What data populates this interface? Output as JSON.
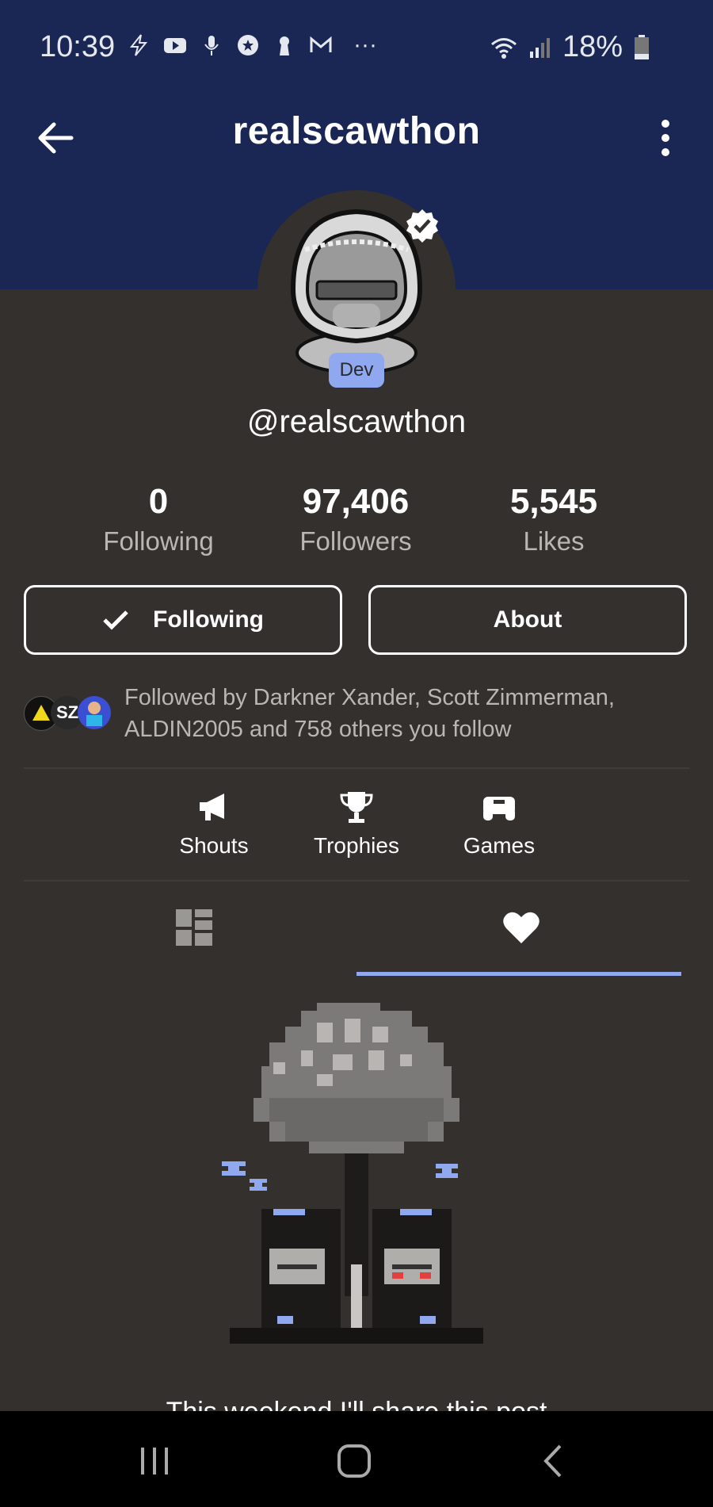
{
  "status_bar": {
    "time": "10:39",
    "battery": "18%",
    "overflow": "···"
  },
  "header": {
    "title": "realscawthon",
    "accent_color": "#1a2654"
  },
  "profile": {
    "handle": "@realscawthon",
    "badge": "Dev",
    "verified": true
  },
  "stats": [
    {
      "value": "0",
      "label": "Following"
    },
    {
      "value": "97,406",
      "label": "Followers"
    },
    {
      "value": "5,545",
      "label": "Likes"
    }
  ],
  "actions": {
    "following_label": "Following",
    "about_label": "About"
  },
  "followed_by": {
    "text": "Followed by Darkner Xander, Scott Zimmerman, ALDIN2005 and 758 others you follow",
    "mini_label": "SZ"
  },
  "quick_links": [
    {
      "label": "Shouts",
      "icon": "megaphone-icon"
    },
    {
      "label": "Trophies",
      "icon": "trophy-icon"
    },
    {
      "label": "Games",
      "icon": "gamepad-icon"
    }
  ],
  "tabs": [
    {
      "icon": "grid-icon",
      "active": false
    },
    {
      "icon": "heart-icon",
      "active": true
    }
  ],
  "content": {
    "cutoff_caption": "This weekend I'll share this post"
  }
}
